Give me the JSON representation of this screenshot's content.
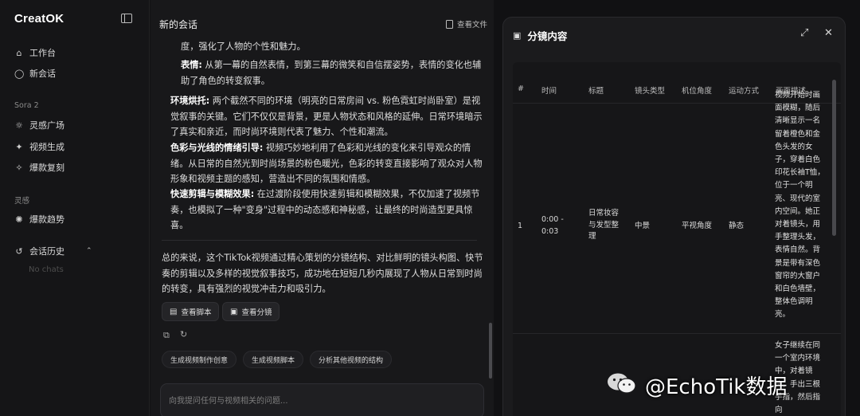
{
  "sidebar": {
    "logo": "CreatOK",
    "nav_main": [
      {
        "label": "工作台",
        "icon": "home-icon"
      },
      {
        "label": "新会话",
        "icon": "chat-bubble-icon"
      }
    ],
    "section_sora": "Sora 2",
    "nav_sora": [
      {
        "label": "灵感广场",
        "icon": "lightbulb-icon"
      },
      {
        "label": "视频生成",
        "icon": "sparkle-icon"
      },
      {
        "label": "爆款复刻",
        "icon": "magic-wand-icon"
      }
    ],
    "section_inspiration": "灵感",
    "nav_inspiration": [
      {
        "label": "爆款趋势",
        "icon": "trend-icon"
      }
    ],
    "history_label": "会话历史",
    "no_chats": "No chats"
  },
  "chat": {
    "title": "新的会话",
    "view_file": "查看文件",
    "p1": "度，强化了人物的个性和魅力。",
    "p2_bold": "表情:",
    "p2_text": " 从第一幕的自然表情，到第三幕的微笑和自信摆姿势，表情的变化也辅助了角色的转变叙事。",
    "p3_bold": "环境烘托:",
    "p3_text": " 两个截然不同的环境（明亮的日常房间 vs. 粉色霓虹时尚卧室）是视觉叙事的关键。它们不仅仅是背景，更是人物状态和风格的延伸。日常环境暗示了真实和亲近，而时尚环境则代表了魅力、个性和潮流。",
    "p4_bold": "色彩与光线的情绪引导:",
    "p4_text": " 视频巧妙地利用了色彩和光线的变化来引导观众的情绪。从日常的自然光到时尚场景的粉色暖光，色彩的转变直接影响了观众对人物形象和视频主题的感知，营造出不同的氛围和情感。",
    "p5_bold": "快速剪辑与模糊效果:",
    "p5_text": " 在过渡阶段使用快速剪辑和模糊效果，不仅加速了视频节奏，也模拟了一种\"变身\"过程中的动态感和神秘感，让最终的时尚造型更具惊喜。",
    "summary": "总的来说，这个TikTok视频通过精心策划的分镜结构、对比鲜明的镜头构图、快节奏的剪辑以及多样的视觉叙事技巧，成功地在短短几秒内展现了人物从日常到时尚的转变，具有强烈的视觉冲击力和吸引力。",
    "btn_script": "查看脚本",
    "btn_storyboard": "查看分镜",
    "suggestions": [
      "生成视频制作创意",
      "生成视频脚本",
      "分析其他视频的结构"
    ],
    "input_placeholder": "向我提问任何与视频相关的问题..."
  },
  "panel": {
    "title": "分镜内容",
    "headers": [
      "#",
      "时间",
      "标题",
      "镜头类型",
      "机位角度",
      "运动方式",
      "画面描述"
    ],
    "rows": [
      {
        "index": "1",
        "time": "0:00 - 0:03",
        "title": "日常妆容与发型整理",
        "shot": "中景",
        "angle": "平视角度",
        "motion": "静态",
        "desc": "视频开始时画面模糊，随后清晰显示一名留着橙色和金色头发的女子，穿着白色印花长袖T恤，位于一个明亮、现代的室内空间。她正对着镜头，用手整理头发，表情自然。背景是带有深色窗帘的大窗户和白色墙壁，整体色调明亮。"
      },
      {
        "desc": "女子继续在同一个室内环境中，对着镜头，手出三根手指，然后指向"
      }
    ]
  },
  "watermark": {
    "text": "@EchoTik数据"
  }
}
